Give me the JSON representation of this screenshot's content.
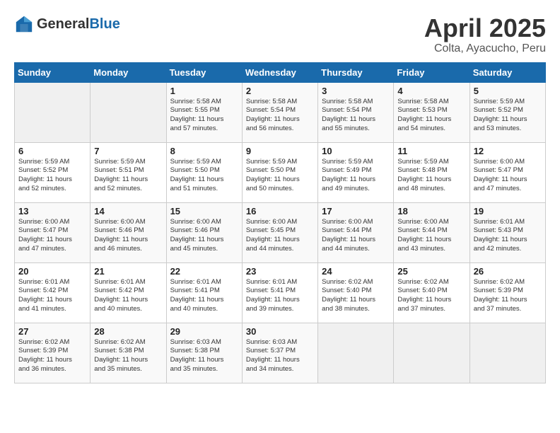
{
  "header": {
    "logo_general": "General",
    "logo_blue": "Blue",
    "month": "April 2025",
    "location": "Colta, Ayacucho, Peru"
  },
  "weekdays": [
    "Sunday",
    "Monday",
    "Tuesday",
    "Wednesday",
    "Thursday",
    "Friday",
    "Saturday"
  ],
  "weeks": [
    [
      {
        "day": "",
        "info": ""
      },
      {
        "day": "",
        "info": ""
      },
      {
        "day": "1",
        "info": "Sunrise: 5:58 AM\nSunset: 5:55 PM\nDaylight: 11 hours\nand 57 minutes."
      },
      {
        "day": "2",
        "info": "Sunrise: 5:58 AM\nSunset: 5:54 PM\nDaylight: 11 hours\nand 56 minutes."
      },
      {
        "day": "3",
        "info": "Sunrise: 5:58 AM\nSunset: 5:54 PM\nDaylight: 11 hours\nand 55 minutes."
      },
      {
        "day": "4",
        "info": "Sunrise: 5:58 AM\nSunset: 5:53 PM\nDaylight: 11 hours\nand 54 minutes."
      },
      {
        "day": "5",
        "info": "Sunrise: 5:59 AM\nSunset: 5:52 PM\nDaylight: 11 hours\nand 53 minutes."
      }
    ],
    [
      {
        "day": "6",
        "info": "Sunrise: 5:59 AM\nSunset: 5:52 PM\nDaylight: 11 hours\nand 52 minutes."
      },
      {
        "day": "7",
        "info": "Sunrise: 5:59 AM\nSunset: 5:51 PM\nDaylight: 11 hours\nand 52 minutes."
      },
      {
        "day": "8",
        "info": "Sunrise: 5:59 AM\nSunset: 5:50 PM\nDaylight: 11 hours\nand 51 minutes."
      },
      {
        "day": "9",
        "info": "Sunrise: 5:59 AM\nSunset: 5:50 PM\nDaylight: 11 hours\nand 50 minutes."
      },
      {
        "day": "10",
        "info": "Sunrise: 5:59 AM\nSunset: 5:49 PM\nDaylight: 11 hours\nand 49 minutes."
      },
      {
        "day": "11",
        "info": "Sunrise: 5:59 AM\nSunset: 5:48 PM\nDaylight: 11 hours\nand 48 minutes."
      },
      {
        "day": "12",
        "info": "Sunrise: 6:00 AM\nSunset: 5:47 PM\nDaylight: 11 hours\nand 47 minutes."
      }
    ],
    [
      {
        "day": "13",
        "info": "Sunrise: 6:00 AM\nSunset: 5:47 PM\nDaylight: 11 hours\nand 47 minutes."
      },
      {
        "day": "14",
        "info": "Sunrise: 6:00 AM\nSunset: 5:46 PM\nDaylight: 11 hours\nand 46 minutes."
      },
      {
        "day": "15",
        "info": "Sunrise: 6:00 AM\nSunset: 5:46 PM\nDaylight: 11 hours\nand 45 minutes."
      },
      {
        "day": "16",
        "info": "Sunrise: 6:00 AM\nSunset: 5:45 PM\nDaylight: 11 hours\nand 44 minutes."
      },
      {
        "day": "17",
        "info": "Sunrise: 6:00 AM\nSunset: 5:44 PM\nDaylight: 11 hours\nand 44 minutes."
      },
      {
        "day": "18",
        "info": "Sunrise: 6:00 AM\nSunset: 5:44 PM\nDaylight: 11 hours\nand 43 minutes."
      },
      {
        "day": "19",
        "info": "Sunrise: 6:01 AM\nSunset: 5:43 PM\nDaylight: 11 hours\nand 42 minutes."
      }
    ],
    [
      {
        "day": "20",
        "info": "Sunrise: 6:01 AM\nSunset: 5:42 PM\nDaylight: 11 hours\nand 41 minutes."
      },
      {
        "day": "21",
        "info": "Sunrise: 6:01 AM\nSunset: 5:42 PM\nDaylight: 11 hours\nand 40 minutes."
      },
      {
        "day": "22",
        "info": "Sunrise: 6:01 AM\nSunset: 5:41 PM\nDaylight: 11 hours\nand 40 minutes."
      },
      {
        "day": "23",
        "info": "Sunrise: 6:01 AM\nSunset: 5:41 PM\nDaylight: 11 hours\nand 39 minutes."
      },
      {
        "day": "24",
        "info": "Sunrise: 6:02 AM\nSunset: 5:40 PM\nDaylight: 11 hours\nand 38 minutes."
      },
      {
        "day": "25",
        "info": "Sunrise: 6:02 AM\nSunset: 5:40 PM\nDaylight: 11 hours\nand 37 minutes."
      },
      {
        "day": "26",
        "info": "Sunrise: 6:02 AM\nSunset: 5:39 PM\nDaylight: 11 hours\nand 37 minutes."
      }
    ],
    [
      {
        "day": "27",
        "info": "Sunrise: 6:02 AM\nSunset: 5:39 PM\nDaylight: 11 hours\nand 36 minutes."
      },
      {
        "day": "28",
        "info": "Sunrise: 6:02 AM\nSunset: 5:38 PM\nDaylight: 11 hours\nand 35 minutes."
      },
      {
        "day": "29",
        "info": "Sunrise: 6:03 AM\nSunset: 5:38 PM\nDaylight: 11 hours\nand 35 minutes."
      },
      {
        "day": "30",
        "info": "Sunrise: 6:03 AM\nSunset: 5:37 PM\nDaylight: 11 hours\nand 34 minutes."
      },
      {
        "day": "",
        "info": ""
      },
      {
        "day": "",
        "info": ""
      },
      {
        "day": "",
        "info": ""
      }
    ]
  ]
}
